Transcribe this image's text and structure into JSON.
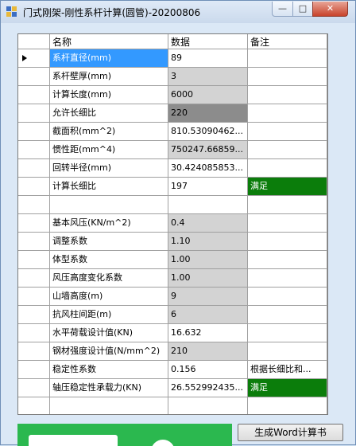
{
  "window": {
    "title": "门式刚架-刚性系杆计算(圆管)-20200806"
  },
  "titlebar": {
    "min_glyph": "—",
    "max_glyph": "□",
    "close_glyph": "✕"
  },
  "grid": {
    "columns": [
      "名称",
      "数据",
      "备注"
    ],
    "rows": [
      {
        "name": "系杆直径(mm)",
        "value": "89",
        "note": ""
      },
      {
        "name": "系杆壁厚(mm)",
        "value": "3",
        "note": ""
      },
      {
        "name": "计算长度(mm)",
        "value": "6000",
        "note": ""
      },
      {
        "name": "允许长细比",
        "value": "220",
        "note": ""
      },
      {
        "name": "截面积(mm^2)",
        "value": "810.53090462...",
        "note": ""
      },
      {
        "name": "惯性距(mm^4)",
        "value": "750247.66859...",
        "note": ""
      },
      {
        "name": "回转半径(mm)",
        "value": "30.424085853...",
        "note": ""
      },
      {
        "name": "计算长细比",
        "value": "197",
        "note": "满足"
      },
      {
        "name": "",
        "value": "",
        "note": ""
      },
      {
        "name": "基本风压(KN/m^2)",
        "value": "0.4",
        "note": ""
      },
      {
        "name": "调整系数",
        "value": "1.10",
        "note": ""
      },
      {
        "name": "体型系数",
        "value": "1.00",
        "note": ""
      },
      {
        "name": "风压高度变化系数",
        "value": "1.00",
        "note": ""
      },
      {
        "name": "山墙高度(m)",
        "value": "9",
        "note": ""
      },
      {
        "name": "抗风柱间距(m)",
        "value": "6",
        "note": ""
      },
      {
        "name": "水平荷载设计值(KN)",
        "value": "16.632",
        "note": ""
      },
      {
        "name": "钢材强度设计值(N/mm^2)",
        "value": "210",
        "note": ""
      },
      {
        "name": "稳定性系数",
        "value": "0.156",
        "note": "根据长细比和..."
      },
      {
        "name": "轴压稳定性承载力(KN)",
        "value": "26.552992435...",
        "note": "满足"
      },
      {
        "name": "",
        "value": "",
        "note": ""
      }
    ]
  },
  "buttons": {
    "generate_word": "生成Word计算书"
  },
  "colors": {
    "selection": "#3399ff",
    "ok": "#0b7d0b",
    "readonly": "#d3d3d3",
    "limit": "#8c8c8c"
  }
}
